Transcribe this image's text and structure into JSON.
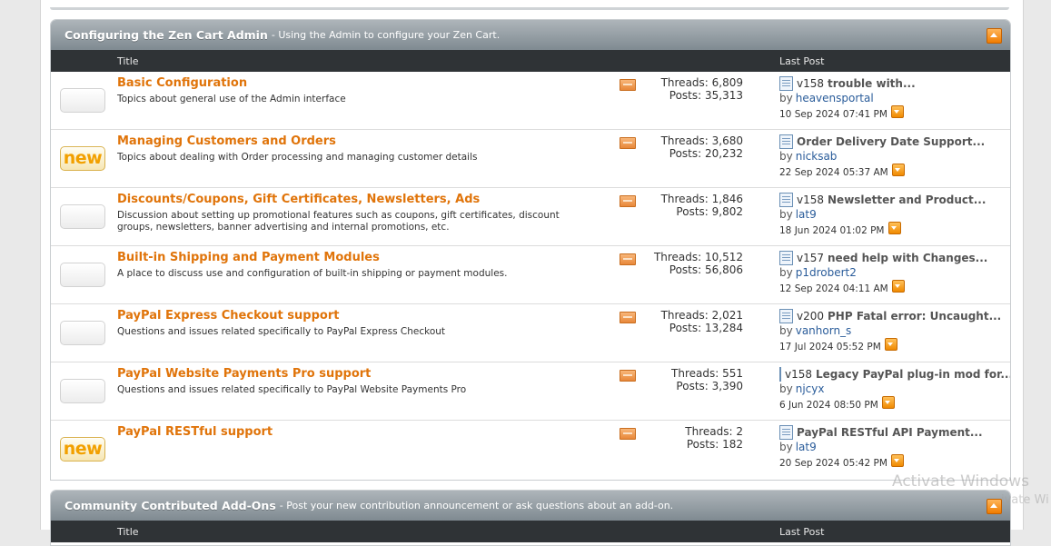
{
  "sections": [
    {
      "title": "Configuring the Zen Cart Admin",
      "description": "- Using the Admin to configure your Zen Cart.",
      "col_title": "Title",
      "col_lastpost": "Last Post",
      "forums": [
        {
          "title": "Basic Configuration",
          "desc": "Topics about general use of the Admin interface",
          "icon": "forum-old-icon",
          "threads": "Threads: 6,809",
          "posts": "Posts: 35,313",
          "lp_prefix": "v158",
          "lp_title": "trouble with...",
          "lp_by": "by",
          "lp_user": "heavensportal",
          "lp_date": "10 Sep 2024 07:41 PM"
        },
        {
          "title": "Managing Customers and Orders",
          "desc": "Topics about dealing with Order processing and managing customer details",
          "icon": "forum-new-icon",
          "new_label": "new",
          "threads": "Threads: 3,680",
          "posts": "Posts: 20,232",
          "lp_prefix": "",
          "lp_title": "Order Delivery Date Support...",
          "lp_by": "by",
          "lp_user": "nicksab",
          "lp_date": "22 Sep 2024 05:37 AM"
        },
        {
          "title": "Discounts/Coupons, Gift Certificates, Newsletters, Ads",
          "desc": "Discussion about setting up promotional features such as coupons, gift certificates, discount groups, newsletters, banner advertising and internal promotions, etc.",
          "icon": "forum-old-icon",
          "threads": "Threads: 1,846",
          "posts": "Posts: 9,802",
          "lp_prefix": "v158",
          "lp_title": "Newsletter and Product...",
          "lp_by": "by",
          "lp_user": "lat9",
          "lp_date": "18 Jun 2024 01:02 PM"
        },
        {
          "title": "Built-in Shipping and Payment Modules",
          "desc": "A place to discuss use and configuration of built-in shipping or payment modules.",
          "icon": "forum-old-icon",
          "threads": "Threads: 10,512",
          "posts": "Posts: 56,806",
          "lp_prefix": "v157",
          "lp_title": "need help with Changes...",
          "lp_by": "by",
          "lp_user": "p1drobert2",
          "lp_date": "12 Sep 2024 04:11 AM"
        },
        {
          "title": "PayPal Express Checkout support",
          "desc": "Questions and issues related specifically to PayPal Express Checkout",
          "icon": "forum-old-icon",
          "threads": "Threads: 2,021",
          "posts": "Posts: 13,284",
          "lp_prefix": "v200",
          "lp_title": "PHP Fatal error: Uncaught...",
          "lp_by": "by",
          "lp_user": "vanhorn_s",
          "lp_date": "17 Jul 2024 05:52 PM"
        },
        {
          "title": "PayPal Website Payments Pro support",
          "desc": "Questions and issues related specifically to PayPal Website Payments Pro",
          "icon": "forum-old-icon",
          "threads": "Threads: 551",
          "posts": "Posts: 3,390",
          "lp_prefix": "v158",
          "lp_title": "Legacy PayPal plug-in mod for...",
          "lp_by": "by",
          "lp_user": "njcyx",
          "lp_date": "6 Jun 2024 08:50 PM"
        },
        {
          "title": "PayPal RESTful support",
          "desc": "",
          "icon": "forum-new-icon",
          "new_label": "new",
          "threads": "Threads: 2",
          "posts": "Posts: 182",
          "lp_prefix": "",
          "lp_title": "PayPal RESTful API Payment...",
          "lp_by": "by",
          "lp_user": "lat9",
          "lp_date": "20 Sep 2024 05:42 PM"
        }
      ]
    },
    {
      "title": "Community Contributed Add-Ons",
      "description": "- Post your new contribution announcement or ask questions about an add-on.",
      "col_title": "Title",
      "col_lastpost": "Last Post"
    }
  ],
  "watermark": {
    "line1": "Activate Windows",
    "line2": "ivate Wi"
  },
  "colors": {
    "forum_title": "#e0740a",
    "header_dark": "#2f3336",
    "user_link": "#2a5c9a",
    "new_badge": "#f2a000"
  }
}
